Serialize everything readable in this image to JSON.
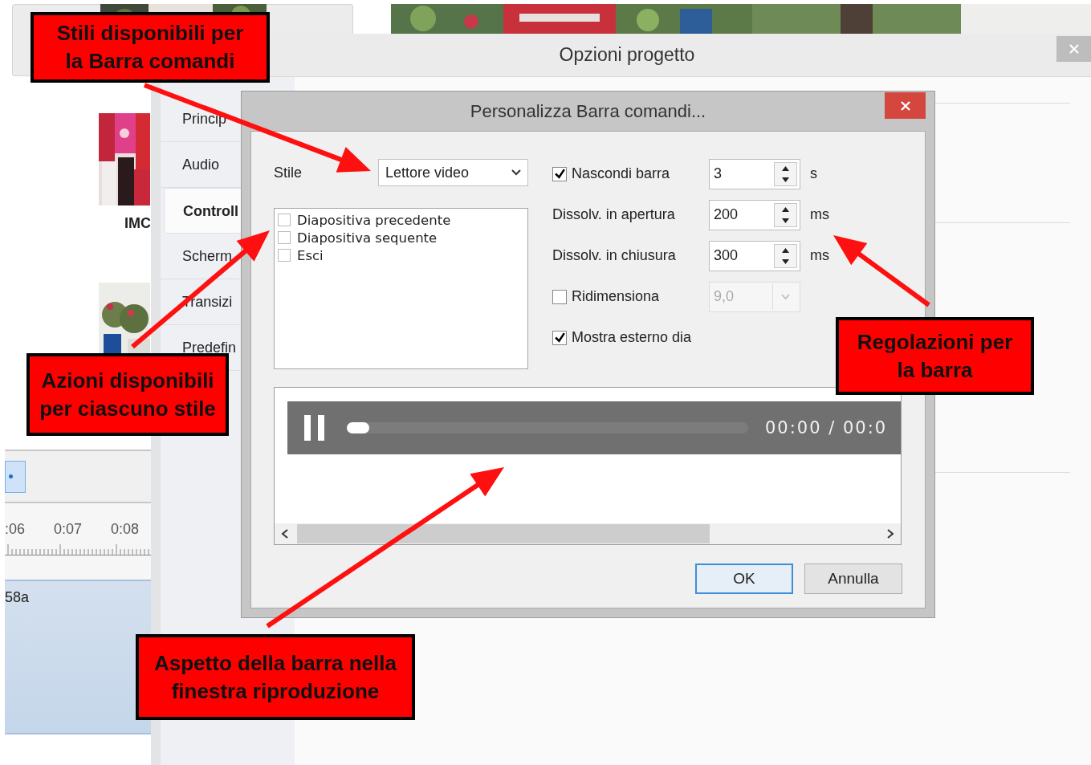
{
  "background_app": {
    "thumbnails": [
      {
        "kind": "picture",
        "caption": "IMC"
      },
      {
        "kind": "picture"
      }
    ],
    "timeline": {
      "ruler_labels": [
        ":06",
        "0:07",
        "0:08"
      ],
      "clip_label": "58a"
    }
  },
  "options_window": {
    "title": "Opzioni progetto",
    "tabs": [
      {
        "label": "Princip",
        "selected": false
      },
      {
        "label": "Audio",
        "selected": false
      },
      {
        "label": "Controll",
        "selected": true
      },
      {
        "label": "Scherm",
        "selected": false
      },
      {
        "label": "Transizi",
        "selected": false
      },
      {
        "label": "Predefin",
        "selected": false
      }
    ]
  },
  "dialog": {
    "title": "Personalizza Barra comandi...",
    "style_label": "Stile",
    "style_value": "Lettore video",
    "actions": [
      {
        "label": "Diapositiva precedente",
        "checked": false
      },
      {
        "label": "Diapositiva sequente",
        "checked": false
      },
      {
        "label": "Esci",
        "checked": false
      }
    ],
    "settings": [
      {
        "kind": "spin",
        "label": "Nascondi barra",
        "checked": true,
        "value": "3",
        "unit": "s"
      },
      {
        "kind": "spin",
        "label": "Dissolv. in apertura",
        "value": "200",
        "unit": "ms"
      },
      {
        "kind": "spin",
        "label": "Dissolv. in chiusura",
        "value": "300",
        "unit": "ms"
      },
      {
        "kind": "combo",
        "label": "Ridimensiona",
        "checked": false,
        "value": "9,0",
        "disabled": true
      },
      {
        "kind": "check",
        "label": "Mostra esterno dia",
        "checked": true
      }
    ],
    "preview": {
      "playing": true,
      "level": 0.03,
      "time": "00:00 / 00:0"
    },
    "buttons": [
      {
        "label": "OK",
        "default": true
      },
      {
        "label": "Annulla",
        "default": false
      }
    ]
  },
  "callouts": [
    {
      "lines": [
        "Stili disponibili per",
        "la Barra comandi"
      ]
    },
    {
      "lines": [
        "Azioni disponibili",
        "per ciascuno stile"
      ]
    },
    {
      "lines": [
        "Regolazioni per",
        "la barra"
      ]
    },
    {
      "lines": [
        "Aspetto della barra nella",
        "finestra riproduzione"
      ]
    }
  ]
}
